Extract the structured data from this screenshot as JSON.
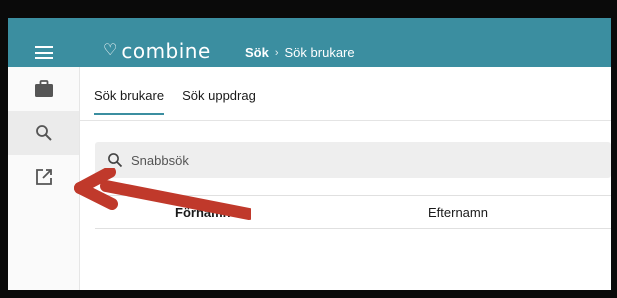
{
  "header": {
    "logo_text": "combine",
    "breadcrumb": [
      "Sök",
      "Sök brukare"
    ],
    "breadcrumb_separator": "›",
    "accent_color": "#3b8ea0"
  },
  "sidebar": {
    "items": [
      {
        "icon": "briefcase-icon",
        "active": false
      },
      {
        "icon": "search-icon",
        "active": true
      },
      {
        "icon": "open-in-new-icon",
        "active": false
      }
    ]
  },
  "tabs": [
    {
      "label": "Sök brukare",
      "active": true
    },
    {
      "label": "Sök uppdrag",
      "active": false
    }
  ],
  "search": {
    "placeholder": "Snabbsök"
  },
  "table": {
    "columns": [
      {
        "label": "Förnamn",
        "sort": "ascending"
      },
      {
        "label": "Efternamn",
        "sort": null
      }
    ]
  },
  "annotation": {
    "type": "arrow",
    "color": "#c0392b"
  }
}
